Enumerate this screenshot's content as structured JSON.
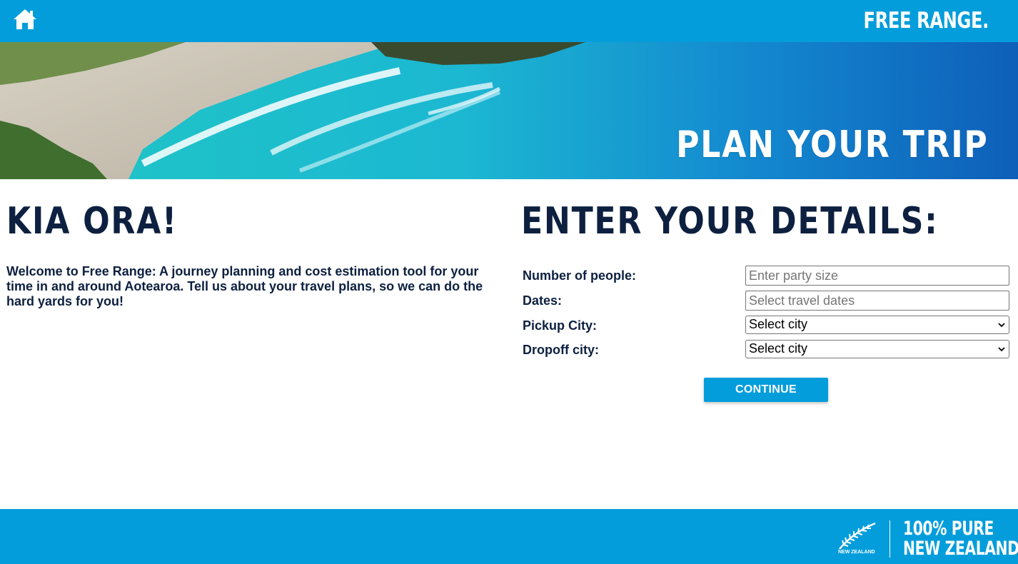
{
  "header": {
    "brand": "FREE RANGE.",
    "home_icon": "home-icon"
  },
  "hero": {
    "title": "PLAN YOUR TRIP"
  },
  "intro": {
    "heading": "KIA ORA!",
    "text": "Welcome to Free Range: A journey planning and cost estimation tool for your time in and around Aotearoa. Tell us about your travel plans, so we can do the hard yards for you!"
  },
  "form": {
    "heading": "ENTER YOUR DETAILS:",
    "people": {
      "label": "Number of people:",
      "placeholder": "Enter party size"
    },
    "dates": {
      "label": "Dates:",
      "placeholder": "Select travel dates"
    },
    "pickup": {
      "label": "Pickup City:",
      "value": "Select city"
    },
    "dropoff": {
      "label": "Dropoff city:",
      "value": "Select city"
    },
    "continue_label": "CONTINUE"
  },
  "footer": {
    "logo_caption": "NEW ZEALAND",
    "slogan_line1": "100% PURE",
    "slogan_line2": "NEW ZEALAND"
  },
  "colors": {
    "accent": "#039ddb",
    "navy": "#0d2040"
  }
}
